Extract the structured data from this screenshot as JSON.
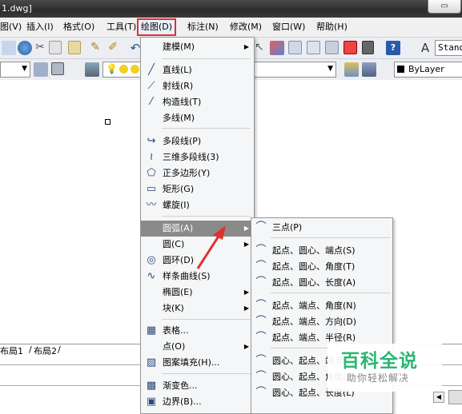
{
  "window": {
    "title": "1.dwg]"
  },
  "menubar": {
    "items": [
      "图(V)",
      "插入(I)",
      "格式(O)",
      "工具(T)",
      "绘图(D)",
      "标注(N)",
      "修改(M)",
      "窗口(W)",
      "帮助(H)"
    ]
  },
  "toolbar": {
    "text_style_value": "Stand",
    "linetype_value": "ByLayer"
  },
  "layout_tabs": [
    "布局1",
    "布局2"
  ],
  "draw_menu": {
    "items": [
      {
        "label": "建模(M)",
        "icon": "",
        "submenu": true
      },
      {
        "label": "直线(L)",
        "icon": "line-icon"
      },
      {
        "label": "射线(R)",
        "icon": "ray-icon"
      },
      {
        "label": "构造线(T)",
        "icon": "construction-line-icon"
      },
      {
        "label": "多线(M)",
        "icon": ""
      },
      {
        "label": "多段线(P)",
        "icon": "polyline-icon"
      },
      {
        "label": "三维多段线(3)",
        "icon": "3d-polyline-icon"
      },
      {
        "label": "正多边形(Y)",
        "icon": "polygon-icon"
      },
      {
        "label": "矩形(G)",
        "icon": "rectangle-icon"
      },
      {
        "label": "螺旋(I)",
        "icon": "helix-icon"
      },
      {
        "label": "圆弧(A)",
        "icon": "",
        "submenu": true,
        "highlighted": true
      },
      {
        "label": "圆(C)",
        "icon": "",
        "submenu": true
      },
      {
        "label": "圆环(D)",
        "icon": "donut-icon"
      },
      {
        "label": "样条曲线(S)",
        "icon": "spline-icon"
      },
      {
        "label": "椭圆(E)",
        "icon": "",
        "submenu": true
      },
      {
        "label": "块(K)",
        "icon": "",
        "submenu": true
      },
      {
        "label": "表格...",
        "icon": "table-icon"
      },
      {
        "label": "点(O)",
        "icon": "",
        "submenu": true
      },
      {
        "label": "图案填充(H)...",
        "icon": "hatch-icon"
      },
      {
        "label": "渐变色...",
        "icon": "gradient-icon"
      },
      {
        "label": "边界(B)...",
        "icon": "boundary-icon"
      }
    ]
  },
  "arc_submenu": {
    "items": [
      {
        "label": "三点(P)"
      },
      {
        "label": "起点、圆心、端点(S)"
      },
      {
        "label": "起点、圆心、角度(T)"
      },
      {
        "label": "起点、圆心、长度(A)"
      },
      {
        "label": "起点、端点、角度(N)"
      },
      {
        "label": "起点、端点、方向(D)"
      },
      {
        "label": "起点、端点、半径(R)"
      },
      {
        "label": "圆心、起点、端点(C)"
      },
      {
        "label": "圆心、起点、角度(E)"
      },
      {
        "label": "圆心、起点、长度(L)"
      }
    ]
  },
  "watermark": {
    "title": "百科全说",
    "subtitle": "助你轻松解决"
  },
  "colors": {
    "highlight": "#8a8a8a",
    "red_box": "#e03030",
    "arrow": "#e03030"
  }
}
